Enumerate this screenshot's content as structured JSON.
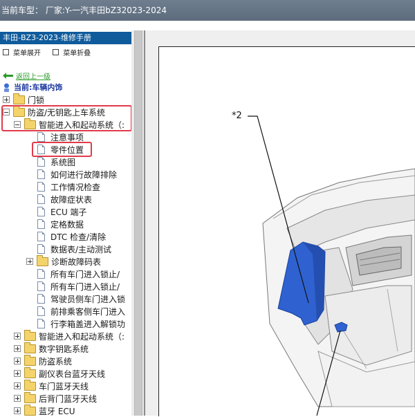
{
  "window": {
    "title": "当前车型：  厂家:Y-一汽丰田bZ32023-2024"
  },
  "sidebar": {
    "header": "丰田-BZ3-2023-维修手册",
    "expand_all": "菜单展开",
    "collapse_all": "菜单折叠",
    "back": "返回上一级",
    "current": "当前:车辆内饰"
  },
  "tree": [
    {
      "label": "门锁",
      "kind": "folder",
      "expander": "plus"
    },
    {
      "label": "防盗/无钥匙上车系统",
      "kind": "folder",
      "expander": "minus"
    },
    {
      "label": "智能进入和起动系统（:",
      "kind": "folder",
      "expander": "minus"
    },
    {
      "label": "注意事项",
      "kind": "doc"
    },
    {
      "label": "零件位置",
      "kind": "doc",
      "selected": true
    },
    {
      "label": "系统图",
      "kind": "doc"
    },
    {
      "label": "如何进行故障排除",
      "kind": "doc"
    },
    {
      "label": "工作情况检查",
      "kind": "doc"
    },
    {
      "label": "故障症状表",
      "kind": "doc"
    },
    {
      "label": "ECU 端子",
      "kind": "doc"
    },
    {
      "label": "定格数据",
      "kind": "doc"
    },
    {
      "label": "DTC 检查/清除",
      "kind": "doc"
    },
    {
      "label": "数据表/主动测试",
      "kind": "doc"
    },
    {
      "label": "诊断故障码表",
      "kind": "folder",
      "expander": "plus"
    },
    {
      "label": "所有车门进入锁止/",
      "kind": "doc"
    },
    {
      "label": "所有车门进入锁止/",
      "kind": "doc"
    },
    {
      "label": "驾驶员侧车门进入锁",
      "kind": "doc"
    },
    {
      "label": "前排乘客侧车门进入",
      "kind": "doc"
    },
    {
      "label": "行李箱盖进入解锁功",
      "kind": "doc"
    },
    {
      "label": "智能进入和起动系统（:",
      "kind": "folder",
      "expander": "plus"
    },
    {
      "label": "数字钥匙系统",
      "kind": "folder",
      "expander": "plus"
    },
    {
      "label": "防盗系统",
      "kind": "folder",
      "expander": "plus"
    },
    {
      "label": "副仪表台蓝牙天线",
      "kind": "folder",
      "expander": "plus"
    },
    {
      "label": "车门蓝牙天线",
      "kind": "folder",
      "expander": "plus"
    },
    {
      "label": "后背门蓝牙天线",
      "kind": "folder",
      "expander": "plus"
    },
    {
      "label": "蓝牙 ECU",
      "kind": "folder",
      "expander": "plus"
    }
  ],
  "diagram": {
    "callout": "*2"
  },
  "colors": {
    "title_bar": "#6f7e8f",
    "sidebar_header": "#0f5b9c",
    "highlight": "#e23a4a",
    "part_highlight": "#2f62d0",
    "link_green": "#2a9b2a"
  }
}
